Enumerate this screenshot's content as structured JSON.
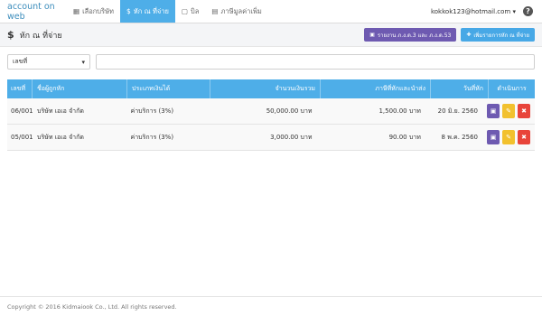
{
  "app": {
    "brand": "account on web"
  },
  "nav": {
    "items": [
      {
        "label": "เลือกบริษัท",
        "icon": "building-icon",
        "active": false
      },
      {
        "label": "หัก ณ ที่จ่าย",
        "icon": "dollar-icon",
        "active": true
      },
      {
        "label": "บิล",
        "icon": "document-icon",
        "active": false
      },
      {
        "label": "ภาษีมูลค่าเพิ่ม",
        "icon": "book-icon",
        "active": false
      }
    ],
    "user_email": "kokkok123@hotmail.com",
    "help": "?"
  },
  "header": {
    "title": "หัก ณ ที่จ่าย",
    "report_button": "รายงาน ภ.ง.ด.3 และ ภ.ง.ด.53",
    "add_button": "เพิ่มรายการหัก ณ ที่จ่าย"
  },
  "filter": {
    "select_value": "เลขที่",
    "search_value": ""
  },
  "table": {
    "columns": [
      "เลขที่",
      "ชื่อผู้ถูกหัก",
      "ประเภทเงินได้",
      "จำนวนเงินรวม",
      "ภาษีที่หักและนำส่ง",
      "วันที่หัก",
      "ดำเนินการ"
    ],
    "rows": [
      {
        "number": "06/001",
        "name": "บริษัท เอเอ จำกัด",
        "type": "ค่าบริการ (3%)",
        "total": "50,000.00 บาท",
        "tax": "1,500.00 บาท",
        "date": "20 มิ.ย. 2560"
      },
      {
        "number": "05/001",
        "name": "บริษัท เอเอ จำกัด",
        "type": "ค่าบริการ (3%)",
        "total": "3,000.00 บาท",
        "tax": "90.00 บาท",
        "date": "8 พ.ค. 2560"
      }
    ]
  },
  "footer": {
    "text": "Copyright © 2016 Kidmaiook Co., Ltd. All rights reserved."
  },
  "colors": {
    "primary": "#4eaee8",
    "purple": "#6e5ab1",
    "yellow": "#f2c12e",
    "red": "#e8443a",
    "brand": "#3c8dbc"
  }
}
